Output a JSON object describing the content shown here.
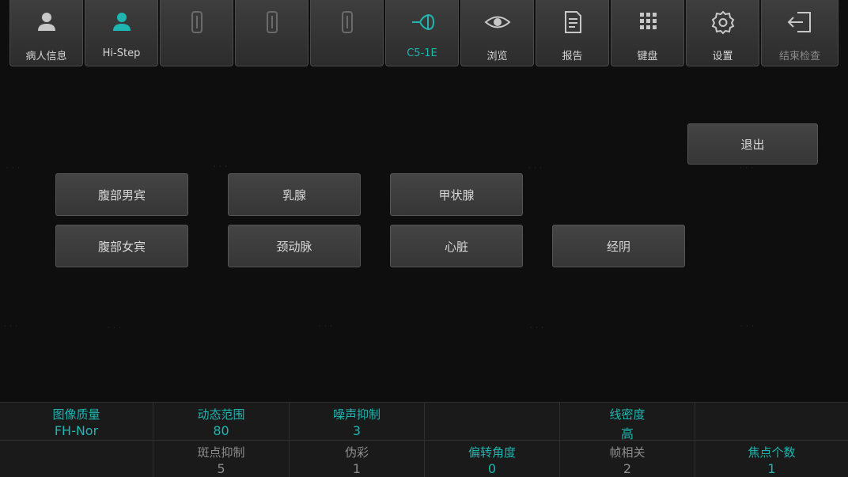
{
  "toolbar": {
    "items": [
      {
        "label": "病人信息",
        "icon": "person-icon"
      },
      {
        "label": "Hi-Step",
        "icon": "person-teal-icon"
      },
      {
        "label": "",
        "icon": "probe-slot-icon"
      },
      {
        "label": "",
        "icon": "probe-slot-icon"
      },
      {
        "label": "",
        "icon": "probe-slot-icon"
      },
      {
        "label": "C5-1E",
        "icon": "convex-probe-icon"
      },
      {
        "label": "浏览",
        "icon": "eye-icon"
      },
      {
        "label": "报告",
        "icon": "document-icon"
      },
      {
        "label": "键盘",
        "icon": "keypad-icon"
      },
      {
        "label": "设置",
        "icon": "gear-icon"
      },
      {
        "label": "结束检查",
        "icon": "exit-arrow-icon"
      }
    ]
  },
  "presets": {
    "exit_label": "退出",
    "row1": [
      "腹部男宾",
      "乳腺",
      "甲状腺"
    ],
    "row2": [
      "腹部女宾",
      "颈动脉",
      "心脏",
      "经阴"
    ]
  },
  "params": {
    "row1": [
      {
        "name": "图像质量",
        "value": "FH-Nor",
        "state": "active"
      },
      {
        "name": "动态范围",
        "value": "80",
        "state": "active"
      },
      {
        "name": "噪声抑制",
        "value": "3",
        "state": "active"
      },
      {
        "name": "",
        "value": "",
        "state": "active"
      },
      {
        "name": "线密度",
        "value": "高",
        "state": "active"
      },
      {
        "name": "",
        "value": "",
        "state": "active"
      }
    ],
    "row2": [
      {
        "name": "",
        "value": "",
        "state": "inactive"
      },
      {
        "name": "斑点抑制",
        "value": "5",
        "state": "inactive"
      },
      {
        "name": "伪彩",
        "value": "1",
        "state": "inactive"
      },
      {
        "name": "偏转角度",
        "value": "0",
        "state": "active"
      },
      {
        "name": "帧相关",
        "value": "2",
        "state": "inactive"
      },
      {
        "name": "焦点个数",
        "value": "1",
        "state": "active"
      }
    ]
  },
  "colors": {
    "accent": "#1fb5b0",
    "button": "#3a3a3a",
    "background": "#0e0e0e"
  }
}
